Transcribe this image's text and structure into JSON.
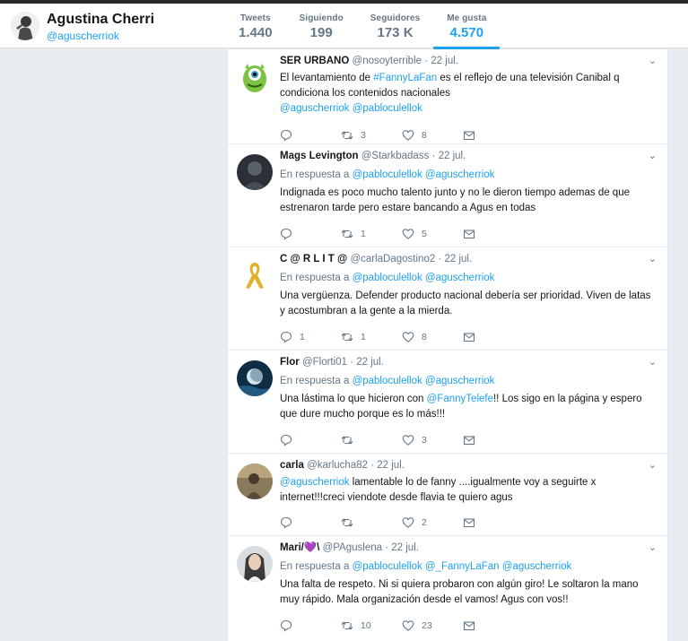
{
  "profile": {
    "name": "Agustina Cherri",
    "handle": "@aguscherriok"
  },
  "stats": [
    {
      "label": "Tweets",
      "value": "1.440",
      "active": false
    },
    {
      "label": "Siguiendo",
      "value": "199",
      "active": false
    },
    {
      "label": "Seguidores",
      "value": "173 K",
      "active": false
    },
    {
      "label": "Me gusta",
      "value": "4.570",
      "active": true
    }
  ],
  "colors": {
    "accent": "#1da1f2",
    "text": "#14171a",
    "muted": "#657786",
    "background": "#e6ecf0"
  },
  "tweets": [
    {
      "name": "SER URBANO",
      "handle": "@nosoyterrible",
      "time": "22 jul.",
      "avatar_icon": "green-monster-icon",
      "reply_prefix": "",
      "reply_mentions": "",
      "text_mention_before": "",
      "text_before": "El levantamiento de ",
      "text_mention": "#FannyLaFan",
      "text_after": " es el reflejo de una televisión Canibal q condiciona los contenidos nacionales",
      "text_mentions_line": "@aguscherriok @pabloculellok",
      "replies": "",
      "retweets": "3",
      "likes": "8"
    },
    {
      "name": "Mags Levington",
      "handle": "@Starkbadass",
      "time": "22 jul.",
      "avatar_icon": "dark-portrait-icon",
      "reply_prefix": "En respuesta a ",
      "reply_mentions": "@pabloculellok @aguscherriok",
      "text_mention_before": "",
      "text_before": "Indignada es poco mucho talento junto y no le dieron tiempo ademas de que estrenaron tarde pero estare bancando a Agus en todas",
      "text_mention": "",
      "text_after": "",
      "text_mentions_line": "",
      "replies": "",
      "retweets": "1",
      "likes": "5"
    },
    {
      "name": "C @ R L I T @",
      "handle": "@carlaDagostino2",
      "time": "22 jul.",
      "avatar_icon": "yellow-ribbon-icon",
      "reply_prefix": "En respuesta a ",
      "reply_mentions": "@pabloculellok @aguscherriok",
      "text_mention_before": "",
      "text_before": "Una vergüenza.  Defender producto nacional debería ser prioridad. Viven de latas y acostumbran a la gente a la mierda.",
      "text_mention": "",
      "text_after": "",
      "text_mentions_line": "",
      "replies": "1",
      "retweets": "1",
      "likes": "8"
    },
    {
      "name": "Flor",
      "handle": "@Florti01",
      "time": "22 jul.",
      "avatar_icon": "night-sky-icon",
      "reply_prefix": "En respuesta a ",
      "reply_mentions": "@pabloculellok @aguscherriok",
      "text_mention_before": "",
      "text_before": "Una lástima lo que hicieron con ",
      "text_mention": "@FannyTelefe",
      "text_after": "!! Los sigo en la página y espero que dure mucho porque es lo más!!!",
      "text_mentions_line": "",
      "replies": "",
      "retweets": "",
      "likes": "3"
    },
    {
      "name": "carla",
      "handle": "@karlucha82",
      "time": "22 jul.",
      "avatar_icon": "photo-portrait-icon",
      "reply_prefix": "",
      "reply_mentions": "",
      "text_mention_before": "@aguscherriok",
      "text_before": "  lamentable lo de fanny ....igualmente voy a seguirte x internet!!!creci   viendote desde flavia te quiero agus",
      "text_mention": "",
      "text_after": "",
      "text_mentions_line": "",
      "replies": "",
      "retweets": "",
      "likes": "2"
    },
    {
      "name": "Mari/💜\\",
      "handle": "@PAguslena",
      "time": "22 jul.",
      "avatar_icon": "girl-portrait-icon",
      "reply_prefix": "En respuesta a ",
      "reply_mentions": "@pabloculellok @_FannyLaFan @aguscherriok",
      "text_mention_before": "",
      "text_before": "Una falta de respeto. Ni si quiera probaron con algún giro! Le soltaron la mano muy rápido. Mala organización desde el vamos! Agus con vos!!",
      "text_mention": "",
      "text_after": "",
      "text_mentions_line": "",
      "replies": "",
      "retweets": "10",
      "likes": "23"
    }
  ]
}
